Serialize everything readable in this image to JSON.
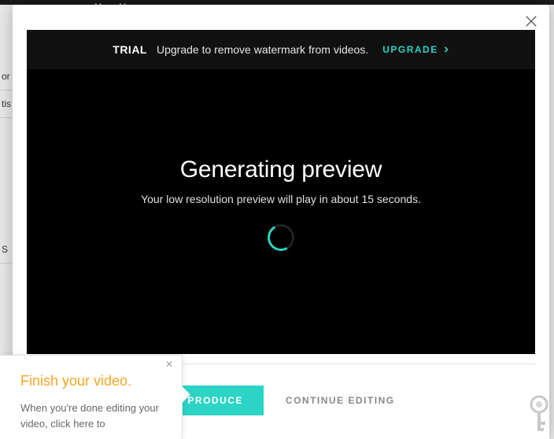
{
  "background": {
    "crumb": "Merry Mem",
    "left_items": [
      "or",
      "tis",
      "",
      "S"
    ]
  },
  "modal": {
    "trial": {
      "label": "TRIAL",
      "message": "Upgrade to remove watermark from videos.",
      "cta": "UPGRADE"
    },
    "preview": {
      "title": "Generating preview",
      "subtitle": "Your low resolution preview will play in about 15 seconds."
    },
    "footer": {
      "produce": "PRODUCE",
      "continue": "CONTINUE EDITING"
    }
  },
  "tip": {
    "title": "Finish your video.",
    "body": "When you're done editing your video, click here to"
  }
}
